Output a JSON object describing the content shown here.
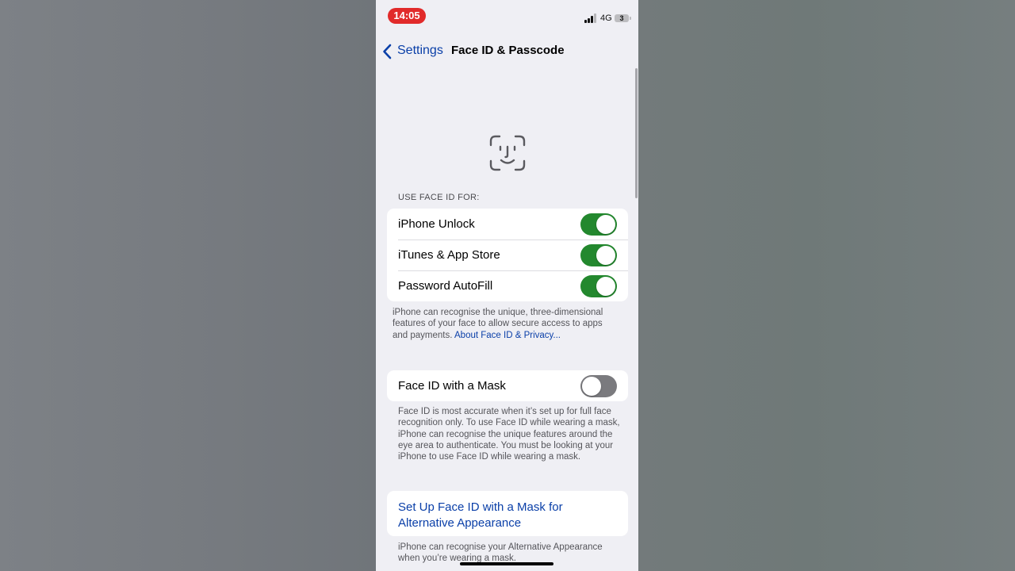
{
  "status_bar": {
    "time": "14:05",
    "network": "4G",
    "battery_level": "3",
    "time_pill_color": "#e12a2a"
  },
  "nav": {
    "back_label": "Settings",
    "title": "Face ID & Passcode",
    "back_icon": "chevron-left-icon"
  },
  "hero_icon": "face-id-icon",
  "use_face_id": {
    "header": "USE FACE ID FOR:",
    "items": [
      {
        "label": "iPhone Unlock",
        "on": true
      },
      {
        "label": "iTunes & App Store",
        "on": true
      },
      {
        "label": "Password AutoFill",
        "on": true
      }
    ],
    "footer": "iPhone can recognise the unique, three-dimensional features of your face to allow secure access to apps and payments.",
    "footer_link": "About Face ID & Privacy..."
  },
  "mask": {
    "label": "Face ID with a Mask",
    "on": false,
    "footer": "Face ID is most accurate when it’s set up for full face recognition only. To use Face ID while wearing a mask, iPhone can recognise the unique features around the eye area to authenticate. You must be looking at your iPhone to use Face ID while wearing a mask."
  },
  "alternative": {
    "link": "Set Up Face ID with a Mask for Alternative Appearance",
    "footer": "iPhone can recognise your Alternative Appearance when you’re wearing a mask."
  },
  "colors": {
    "toggle_on": "#23882e",
    "toggle_off": "#7a7a7e",
    "link": "#0a3fa8",
    "page_background": "#efeff4"
  }
}
